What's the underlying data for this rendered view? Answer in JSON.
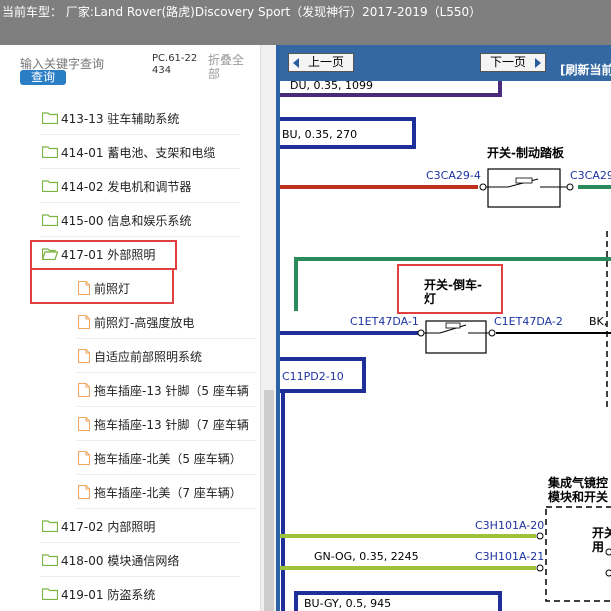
{
  "header": {
    "title": "当前车型：   厂家:Land Rover(路虎)Discovery Sport（发现神行）2017-2019（L550）"
  },
  "sidebar": {
    "search_placeholder": "输入关键字查询",
    "search_button": "查询",
    "pc_code": "PC.61-22434",
    "collapse_all": "折叠全部",
    "items": [
      {
        "label": "413-13 驻车辅助系统",
        "type": "folder"
      },
      {
        "label": "414-01 蓄电池、支架和电缆",
        "type": "folder"
      },
      {
        "label": "414-02 发电机和调节器",
        "type": "folder"
      },
      {
        "label": "415-00 信息和娱乐系统",
        "type": "folder"
      },
      {
        "label": "417-01 外部照明",
        "type": "folder-open"
      },
      {
        "label": "前照灯",
        "type": "document"
      },
      {
        "label": "前照灯-高强度放电",
        "type": "document"
      },
      {
        "label": "自适应前部照明系统",
        "type": "document"
      },
      {
        "label": "拖车插座-13 针脚（5 座车辆",
        "type": "document"
      },
      {
        "label": "拖车插座-13 针脚（7 座车辆",
        "type": "document"
      },
      {
        "label": "拖车插座-北美（5 座车辆）",
        "type": "document"
      },
      {
        "label": "拖车插座-北美（7 座车辆）",
        "type": "document"
      },
      {
        "label": "417-02 内部照明",
        "type": "folder"
      },
      {
        "label": "418-00 模块通信网络",
        "type": "folder"
      },
      {
        "label": "419-01 防盗系统",
        "type": "folder"
      }
    ]
  },
  "viewer": {
    "prev_label": "上一页",
    "next_label": "下一页",
    "refresh_label": "[刷新当前"
  },
  "diagram": {
    "top_partial": "DU, 0.35, 1099",
    "wire_bu_label": "BU, 0.35, 270",
    "brake_switch_title": "开关-制动踏板",
    "brake_conn_left": "C3CA29-4",
    "brake_conn_right": "C3CA29-",
    "side_switch_title_1": "开关-倒车-",
    "side_switch_title_2": "灯",
    "side_conn_left": "C1ET47DA-1",
    "side_conn_right": "C1ET47DA-2",
    "side_wire_right": "BK,",
    "pd_conn": "C11PD2-10",
    "airbag_title_1": "集成气镜控",
    "airbag_title_2": "模块和开关",
    "airbag_conn_1": "C3H101A-20",
    "airbag_conn_2": "C3H101A-21",
    "airbag_inner_1": "开关",
    "airbag_inner_2": "用",
    "wire_gn_og": "GN-OG, 0.35, 2245",
    "wire_bu_gy": "BU-GY, 0.5, 945"
  },
  "colors": {
    "toolbar": "#3468a3",
    "highlight": "#e04040",
    "wire_red": "#c0301f",
    "wire_green": "#2a8a5a",
    "wire_blue": "#1f2f9a",
    "wire_yellow_green": "#9fc23a",
    "folder": "#7cb342",
    "document": "#f0a860"
  }
}
